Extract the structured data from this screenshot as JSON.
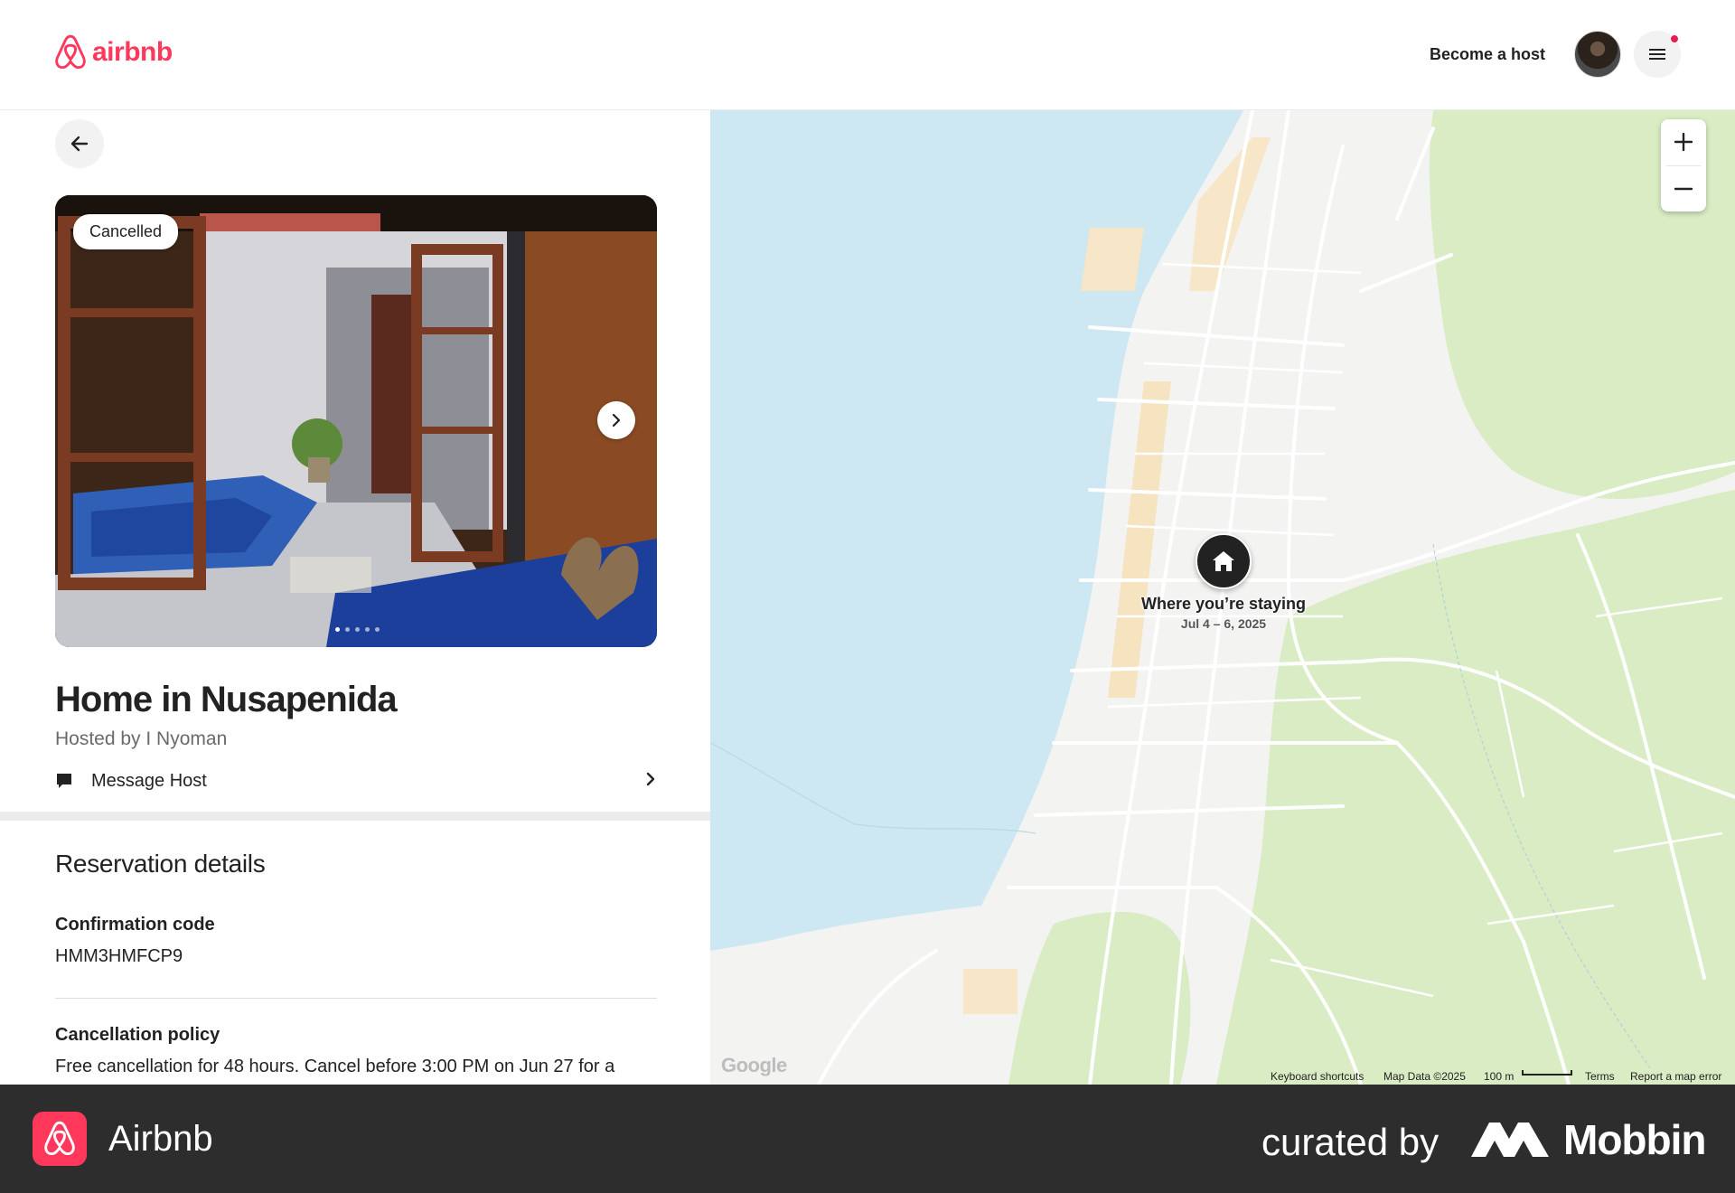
{
  "header": {
    "logo_text": "airbnb",
    "become_host": "Become a host"
  },
  "listing": {
    "status_badge": "Cancelled",
    "title": "Home in Nusapenida",
    "hosted_by": "Hosted by I Nyoman",
    "message_host": "Message Host",
    "photo_count": 5,
    "active_photo": 1
  },
  "reservation": {
    "section_title": "Reservation details",
    "confirmation_label": "Confirmation code",
    "confirmation_code": "HMM3HMFCP9",
    "cancellation_label": "Cancellation policy",
    "cancellation_text": "Free cancellation for 48 hours. Cancel before 3:00 PM on Jun 27 for a"
  },
  "map": {
    "marker_title": "Where you’re staying",
    "marker_dates": "Jul 4 – 6, 2025",
    "zoom_in": "+",
    "zoom_out": "−",
    "google": "Google",
    "keyboard_shortcuts": "Keyboard shortcuts",
    "map_data": "Map Data ©2025",
    "scale": "100 m",
    "terms": "Terms",
    "report": "Report a map error"
  },
  "footer": {
    "app_name": "Airbnb",
    "curated_by": "curated by",
    "brand": "Mobbin"
  },
  "colors": {
    "brand": "#ff385c",
    "water": "#cde8f2",
    "park": "#d9ecc4",
    "land": "#f3f3f1"
  }
}
